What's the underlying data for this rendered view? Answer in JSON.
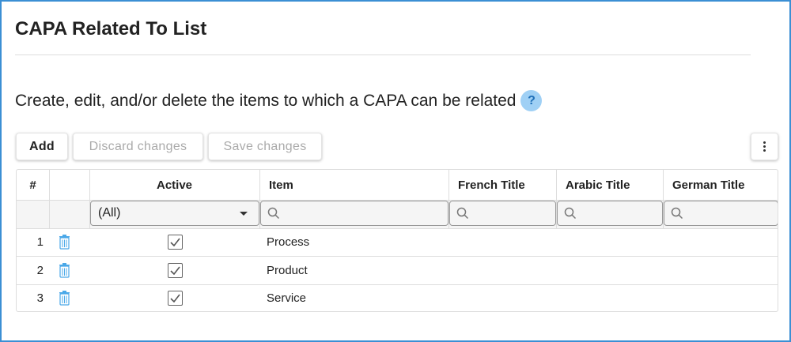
{
  "page": {
    "title": "CAPA Related To List",
    "description": "Create, edit, and/or delete the items to which a CAPA can be related",
    "help_glyph": "?"
  },
  "toolbar": {
    "add_label": "Add",
    "discard_label": "Discard changes",
    "save_label": "Save changes",
    "more_icon": "more-vertical-icon"
  },
  "grid": {
    "columns": [
      "#",
      "",
      "Active",
      "Item",
      "French Title",
      "Arabic Title",
      "German Title"
    ],
    "filters": {
      "active_value": "(All)",
      "item_placeholder": "",
      "french_placeholder": "",
      "arabic_placeholder": "",
      "german_placeholder": ""
    },
    "rows": [
      {
        "num": "1",
        "active": true,
        "item": "Process",
        "french": "",
        "arabic": "",
        "german": ""
      },
      {
        "num": "2",
        "active": true,
        "item": "Product",
        "french": "",
        "arabic": "",
        "german": ""
      },
      {
        "num": "3",
        "active": true,
        "item": "Service",
        "french": "",
        "arabic": "",
        "german": ""
      }
    ]
  },
  "colors": {
    "frame_border": "#3b8fd4",
    "help_bg": "#9fd0f5",
    "trash_icon": "#4aa8e8",
    "disabled_text": "#aaaaaa"
  }
}
